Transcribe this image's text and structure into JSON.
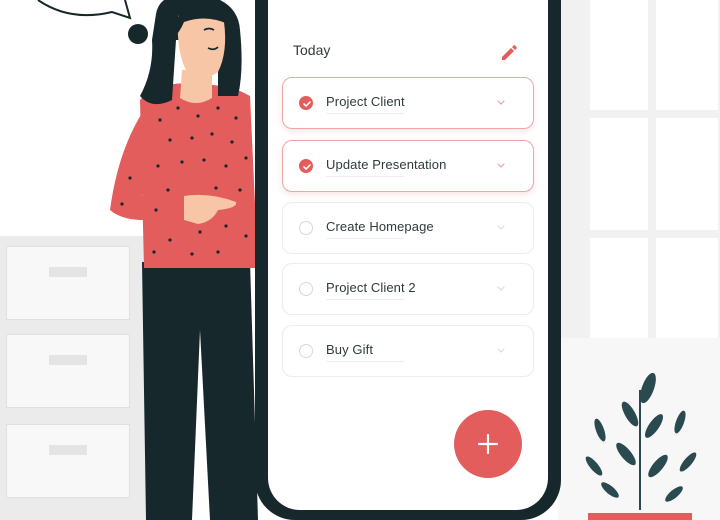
{
  "header": {
    "title": "Today"
  },
  "tasks": [
    {
      "label": "Project Client",
      "checked": true
    },
    {
      "label": "Update Presentation",
      "checked": true
    },
    {
      "label": "Create Homepage",
      "checked": false
    },
    {
      "label": "Project Client 2",
      "checked": false
    },
    {
      "label": "Buy Gift",
      "checked": false
    }
  ],
  "icons": {
    "edit": "pencil-icon",
    "check": "check-icon",
    "expand": "chevron-down-icon",
    "add": "plus-icon"
  },
  "colors": {
    "accent": "#e35d5d",
    "phone_frame": "#17282c",
    "shirt": "#e35d5d",
    "hair": "#17282c",
    "skin": "#f7c6a6",
    "plant": "#2b4a50"
  }
}
